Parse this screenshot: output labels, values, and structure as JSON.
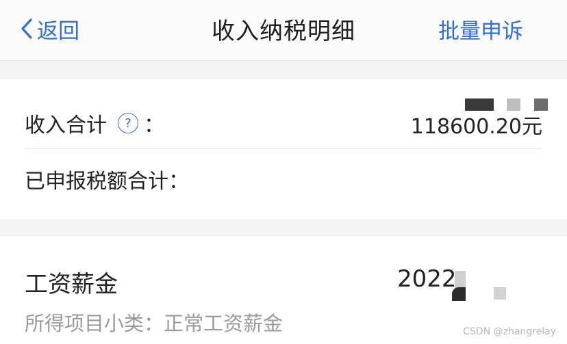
{
  "header": {
    "back_label": "返回",
    "title": "收入纳税明细",
    "action_label": "批量申诉"
  },
  "summary": {
    "income_label": "收入合计",
    "help_glyph": "?",
    "income_colon": "：",
    "income_value": "118600.20元",
    "tax_label": "已申报税额合计："
  },
  "salary": {
    "title": "工资薪金",
    "year": "2022",
    "subcategory": "所得项目小类：正常工资薪金"
  },
  "watermark": "CSDN @zhangrelay",
  "colors": {
    "accent": "#2f6fd6",
    "separator": "#f3f3f3",
    "text_primary": "#222222",
    "text_secondary": "#9a9a9a"
  },
  "icons": {
    "back": "chevron-left-icon",
    "help": "question-circle-icon"
  }
}
